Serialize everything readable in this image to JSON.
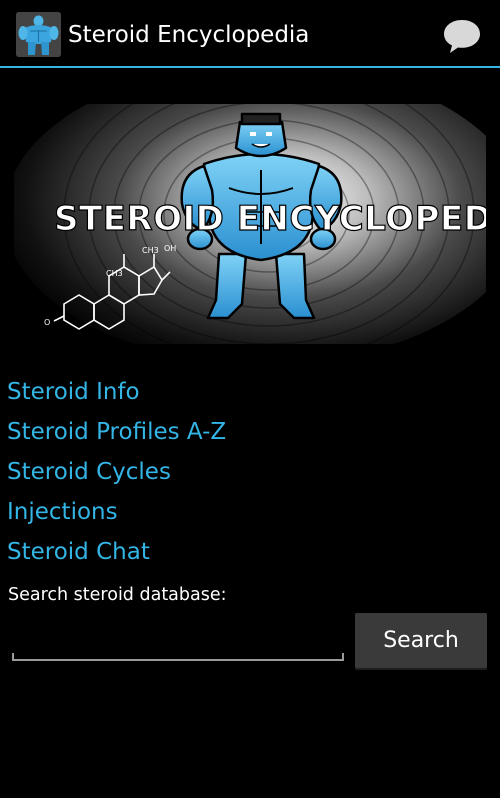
{
  "action_bar": {
    "title": "Steroid Encyclopedia",
    "app_icon": "bodybuilder-icon",
    "overflow_icon": "chat-bubble-icon",
    "accent_color": "#33b5e5"
  },
  "banner": {
    "text": "STEROID ENCYCLOPEDIA",
    "molecule_labels": [
      "OH",
      "CH3",
      "CH3",
      "O"
    ]
  },
  "menu": {
    "items": [
      {
        "label": "Steroid Info"
      },
      {
        "label": "Steroid Profiles A-Z"
      },
      {
        "label": "Steroid Cycles"
      },
      {
        "label": "Injections"
      },
      {
        "label": "Steroid Chat"
      }
    ],
    "link_color": "#33b5e5"
  },
  "search": {
    "label": "Search steroid database:",
    "value": "",
    "placeholder": "",
    "button_label": "Search"
  }
}
